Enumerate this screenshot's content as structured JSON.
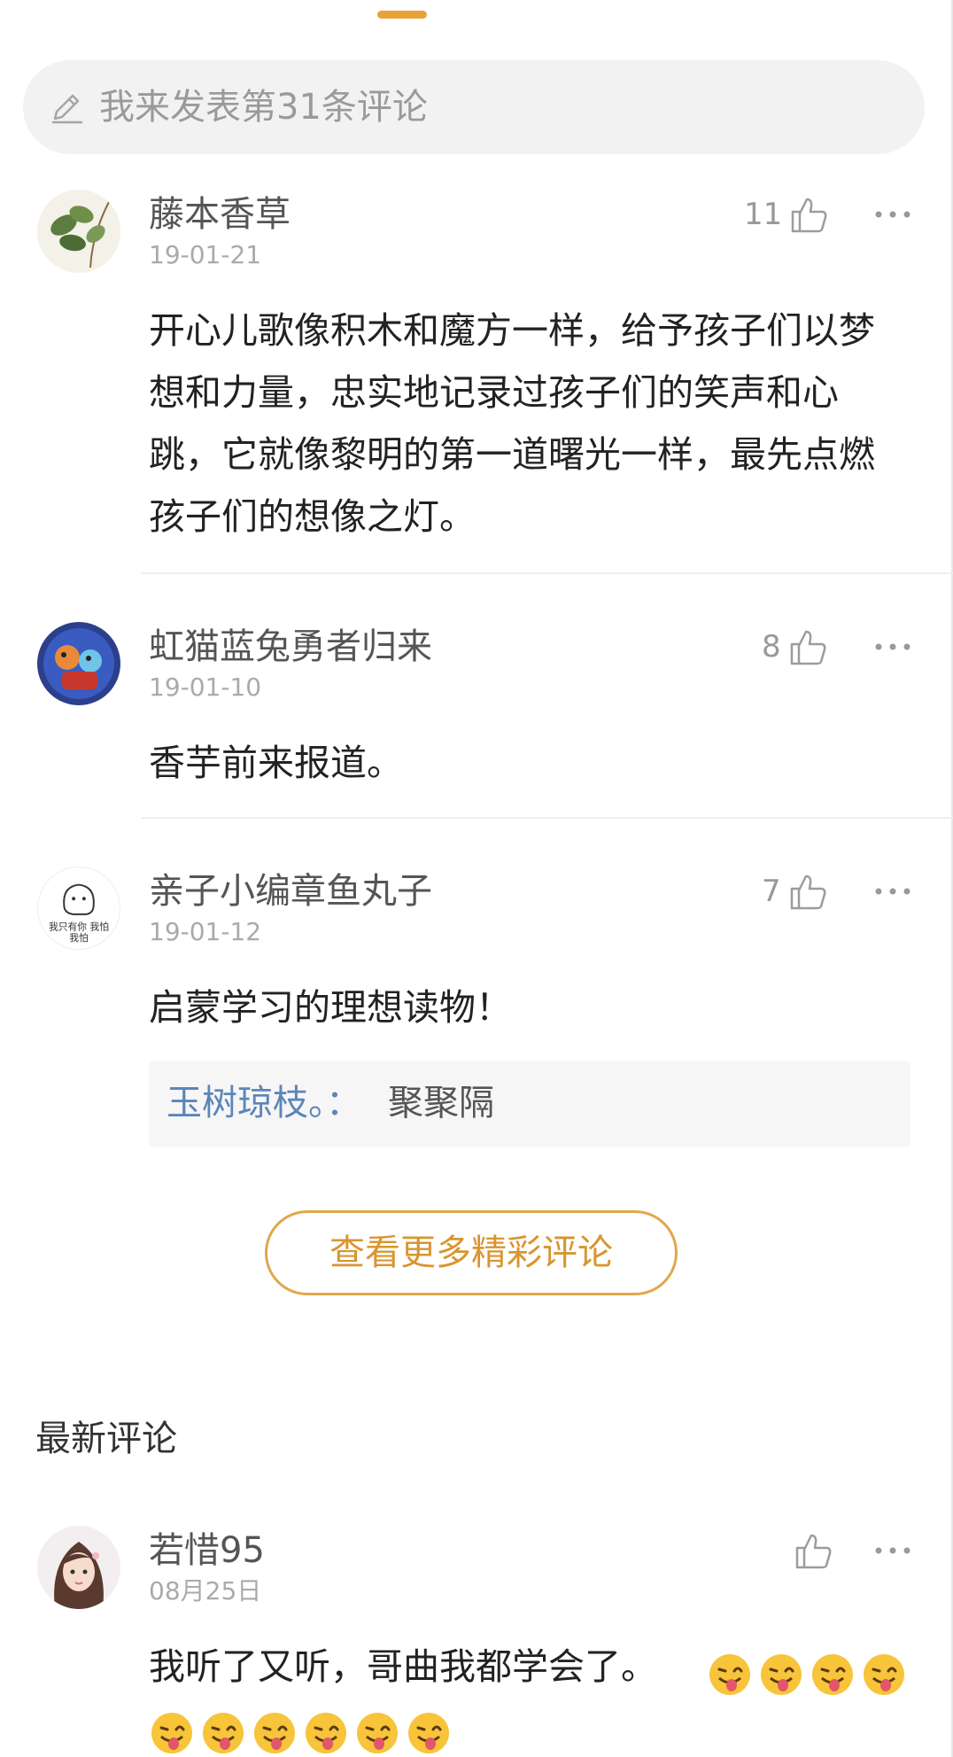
{
  "composer": {
    "placeholder": "我来发表第31条评论"
  },
  "comments": [
    {
      "username": "藤本香草",
      "date": "19-01-21",
      "likes": "11",
      "text": "开心儿歌像积木和魔方一样，给予孩子们以梦想和力量，忠实地记录过孩子们的笑声和心跳，它就像黎明的第一道曙光一样，最先点燃孩子们的想像之灯。"
    },
    {
      "username": "虹猫蓝兔勇者归来",
      "date": "19-01-10",
      "likes": "8",
      "text": "香芋前来报道。"
    },
    {
      "username": "亲子小编章鱼丸子",
      "date": "19-01-12",
      "likes": "7",
      "text": "启蒙学习的理想读物！",
      "avatar_text": "我只有你\n我怕",
      "reply": {
        "user": "玉树琼枝。：",
        "text": "聚聚隔"
      }
    }
  ],
  "more_button": "查看更多精彩评论",
  "latest": {
    "title": "最新评论",
    "comment": {
      "username": "若惜95",
      "date": "08月25日",
      "text": "我听了又听，哥曲我都学会了。",
      "emoji": "😜"
    }
  },
  "colors": {
    "accent": "#e0a74a",
    "link": "#5b86b8",
    "muted": "#aaaaaa"
  },
  "icons": [
    "pencil-icon",
    "thumbs-up-icon",
    "more-icon",
    "winking-tongue-emoji"
  ]
}
